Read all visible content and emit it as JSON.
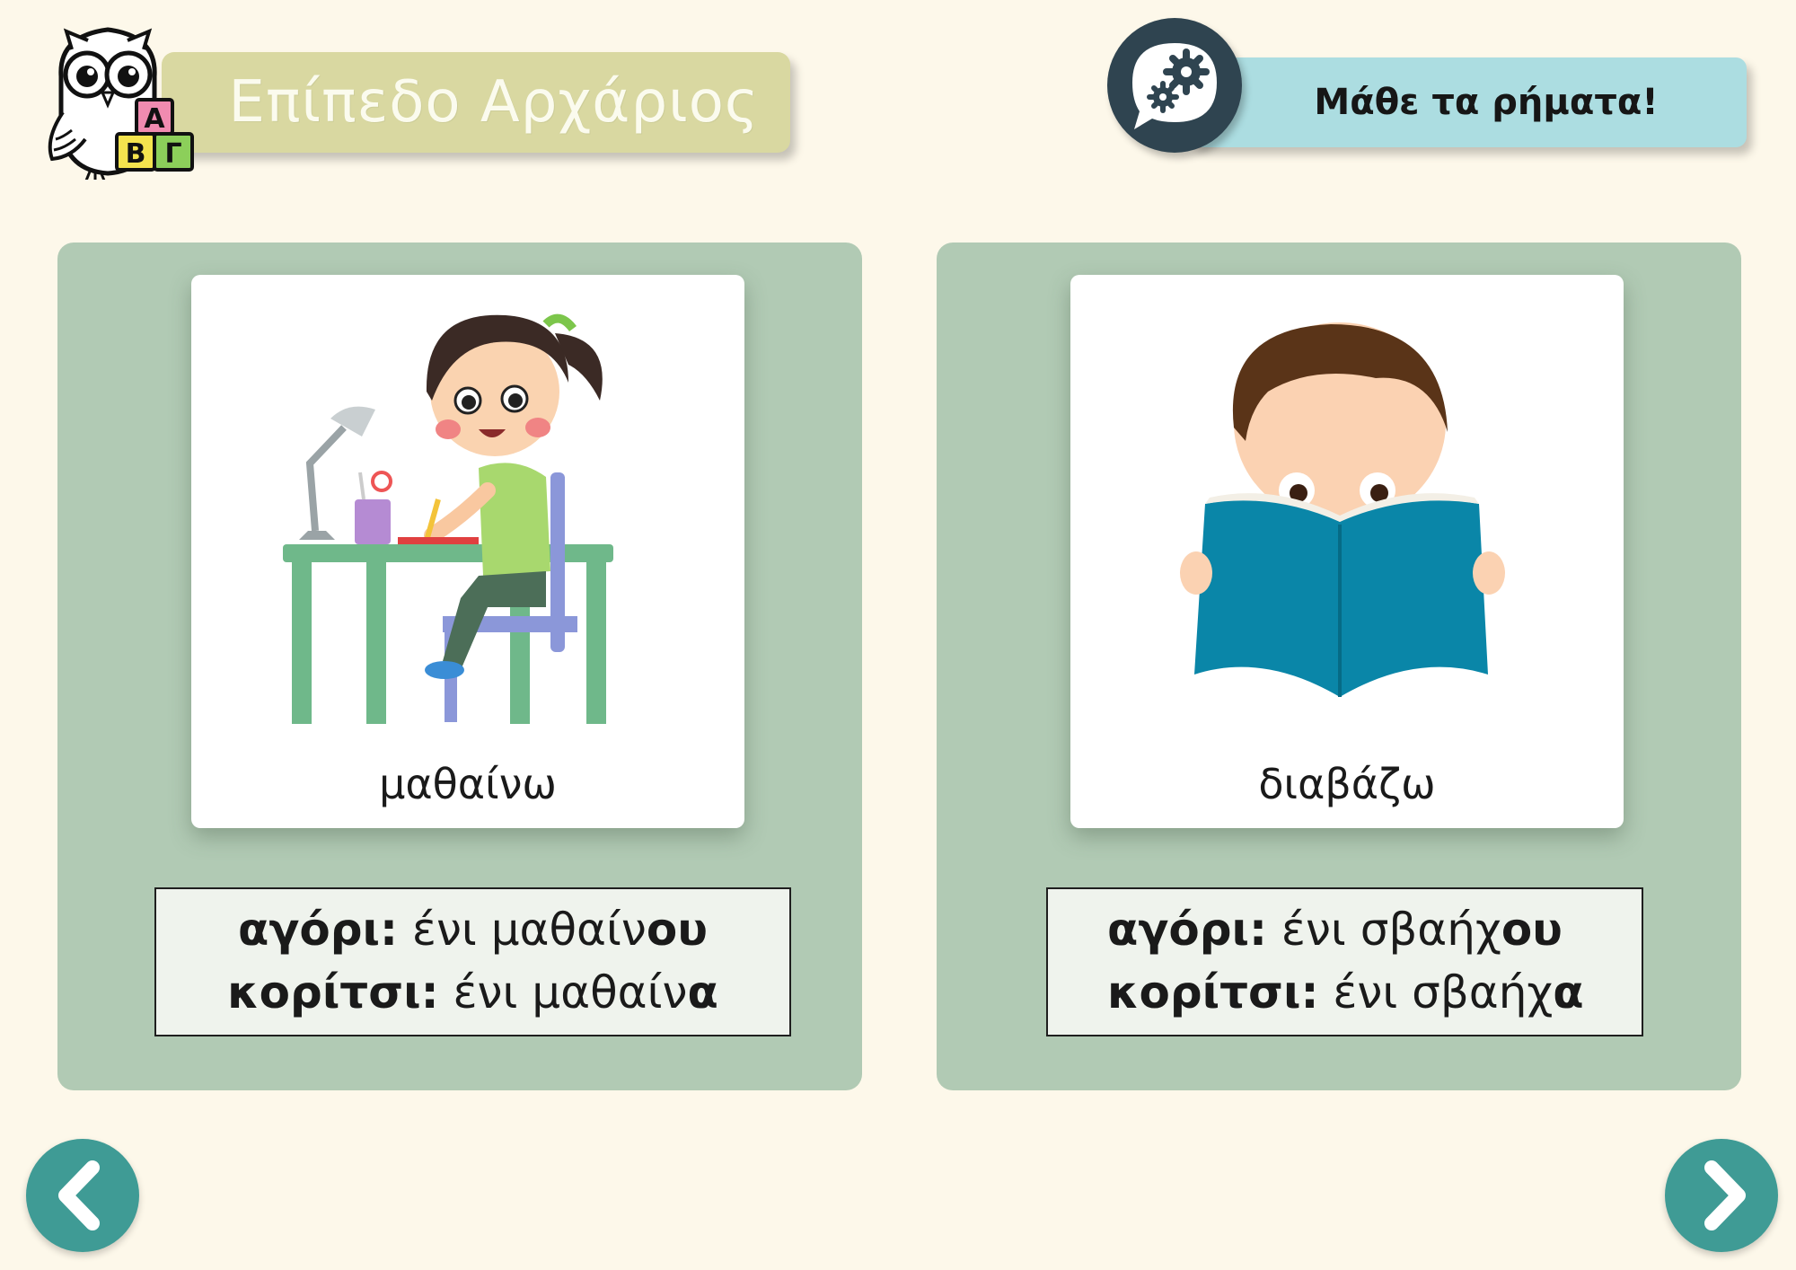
{
  "header": {
    "level_title": "Επίπεδο Αρχάριος",
    "topic_title": "Μάθε τα ρήματα!",
    "logo_blocks": [
      "Α",
      "Β",
      "Γ"
    ]
  },
  "cards": [
    {
      "word": "μαθαίνω",
      "image": "girl-studying-at-desk",
      "boy_label": "αγόρι:",
      "boy_stem": " ένι μαθαίν",
      "boy_ending": "ου",
      "girl_label": "κορίτσι:",
      "girl_stem": " ένι μαθαίν",
      "girl_ending": "α"
    },
    {
      "word": "διαβάζω",
      "image": "boy-reading-book",
      "boy_label": "αγόρι:",
      "boy_stem": " ένι σβαήχ",
      "boy_ending": "ου",
      "girl_label": "κορίτσι:",
      "girl_stem": " ένι σβαήχ",
      "girl_ending": "α"
    }
  ],
  "navigation": {
    "prev_icon": "chevron-left-icon",
    "next_icon": "chevron-right-icon"
  },
  "colors": {
    "background": "#fdf8ea",
    "level_banner": "#d9d8a1",
    "topic_banner": "#acdde1",
    "panel": "#b1cab4",
    "nav_button": "#3f9b95",
    "gear_badge": "#2f4450"
  }
}
